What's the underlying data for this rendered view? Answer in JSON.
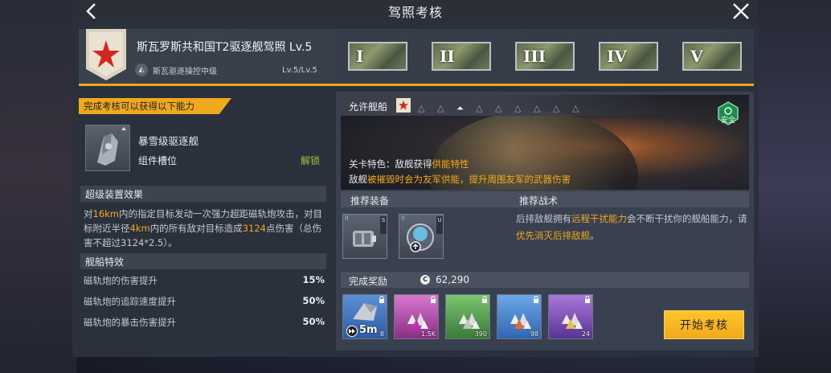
{
  "title": "驾照考核",
  "header": {
    "license_name": "斯瓦罗斯共和国T2驱逐舰驾照 Lv.5",
    "subtitle": "斯瓦驱逐操控中级",
    "level": "Lv.5/Lv.5",
    "rank_tabs": [
      "I",
      "II",
      "III",
      "IV",
      "V"
    ]
  },
  "left": {
    "reward_banner": "完成考核可以获得以下能力",
    "module_name": "暴雪级驱逐舰",
    "module_slot": "组件槽位",
    "unlock": "解锁",
    "super_device_title": "超级装置效果",
    "super_device_parts": {
      "p1": "对",
      "p2": "16km",
      "p3": "内的指定目标发动一次强力超距磁轨炮攻击，对目标附近半径",
      "p4": "4km",
      "p5": "内的所有敌对目标造成",
      "p6": "3124",
      "p7": "点伤害（总伤害不超过3124*2.5）。"
    },
    "ship_traits_title": "舰船特效",
    "traits": [
      {
        "name": "磁轨炮的伤害提升",
        "value": "15%"
      },
      {
        "name": "磁轨炮的追踪速度提升",
        "value": "50%"
      },
      {
        "name": "磁轨炮的暴击伤害提升",
        "value": "50%"
      }
    ]
  },
  "right": {
    "allowed_ships": "允许舰船",
    "safe_label": "安全",
    "feature_title_prefix": "关卡特色：敌舰获得",
    "feature_title_highlight": "供能特性",
    "feature_desc_p1": "敌舰",
    "feature_desc_p2": "被摧毁时会为友军供能，提升周围友军的武器伤害",
    "recommend_equip": "推荐装备",
    "recommend_tactics": "推荐战术",
    "equip1": {
      "tag": "II",
      "side": "S"
    },
    "equip2": {
      "tag": "II",
      "side": "U"
    },
    "tactic_p1": "后排敌舰拥有",
    "tactic_p2": "远程干扰能力",
    "tactic_p3": "会不断干扰你的舰船能力，请",
    "tactic_p4": "优先消灭后排敌舰",
    "tactic_p5": "。",
    "completion_reward": "完成奖励",
    "coin_symbol": "C",
    "coin_value": "62,290",
    "reward_items": [
      {
        "label": "5m",
        "count": "8",
        "color": "#3f78c9"
      },
      {
        "label": "",
        "count": "1.5K",
        "color": "#b63fb0"
      },
      {
        "label": "",
        "count": "390",
        "color": "#4ea650"
      },
      {
        "label": "",
        "count": "98",
        "color": "#3d85d2"
      },
      {
        "label": "",
        "count": "24",
        "color": "#8a4bc4"
      }
    ],
    "start_button": "开始考核"
  },
  "colors": {
    "accent": "#f0a91a",
    "unlock": "#9bc43f",
    "panel": "#2b313c"
  }
}
